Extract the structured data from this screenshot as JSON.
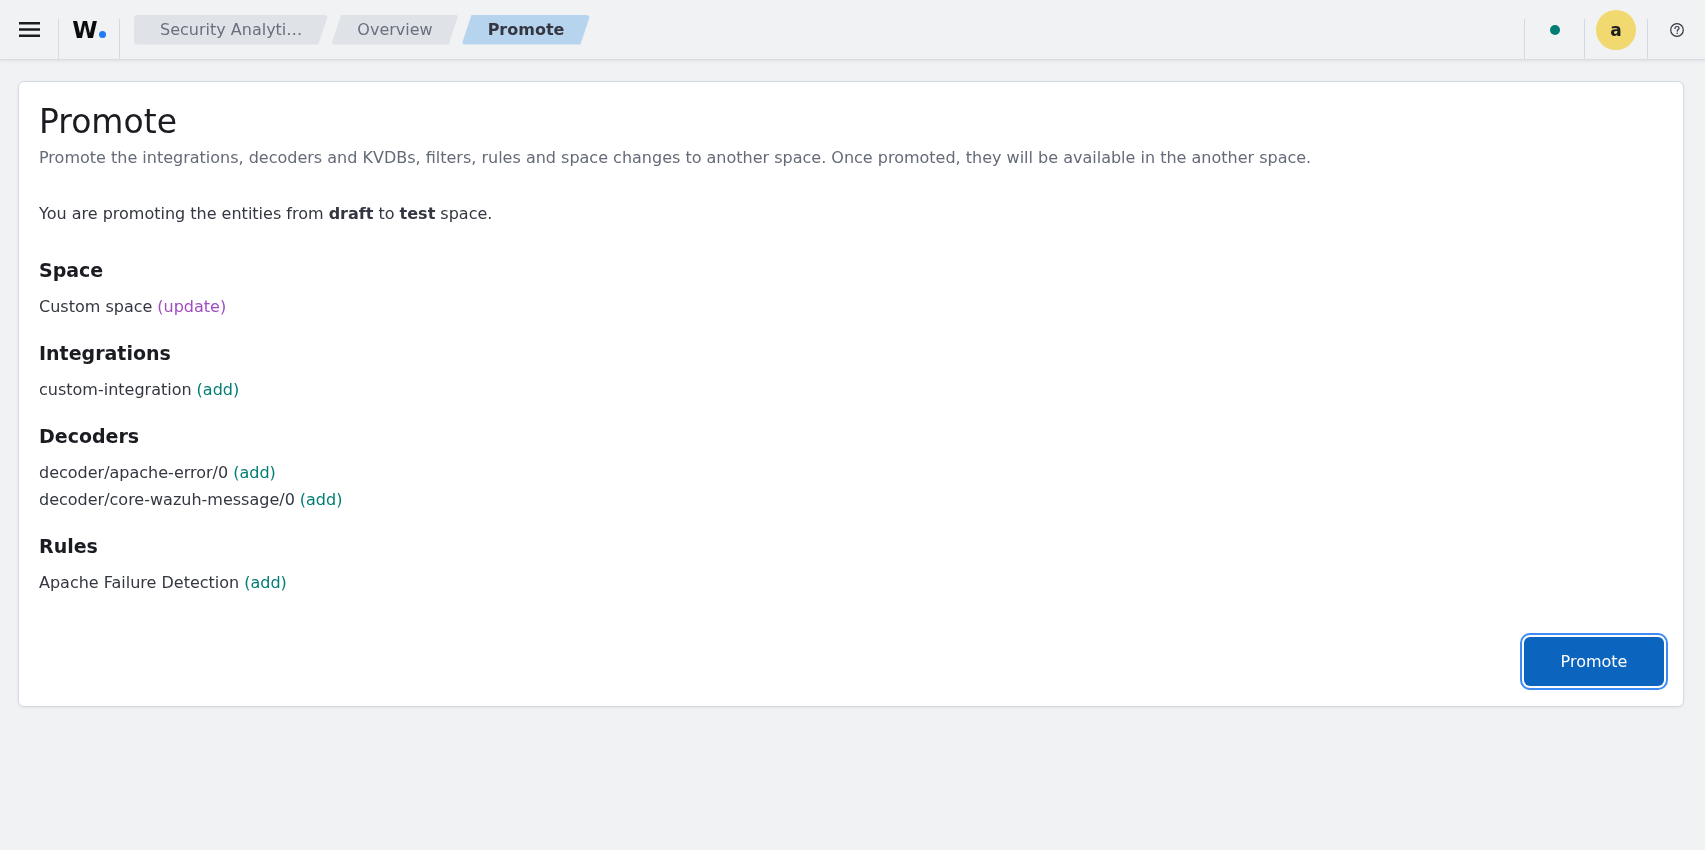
{
  "header": {
    "logo": "W",
    "breadcrumbs": [
      {
        "label": "Security Analyti…",
        "selected": false
      },
      {
        "label": "Overview",
        "selected": false
      },
      {
        "label": "Promote",
        "selected": true
      }
    ],
    "avatar": "a"
  },
  "page": {
    "title": "Promote",
    "description": "Promote the integrations, decoders and KVDBs, filters, rules and space changes to another space. Once promoted, they will be available in the another space.",
    "summary": "You are promoting the entities from **draft** to **test** space.",
    "sections": [
      {
        "heading": "Space",
        "items": [
          {
            "name": "Custom space",
            "action": "(update)",
            "kind": "update"
          }
        ]
      },
      {
        "heading": "Integrations",
        "items": [
          {
            "name": "custom-integration",
            "action": "(add)",
            "kind": "add"
          }
        ]
      },
      {
        "heading": "Decoders",
        "items": [
          {
            "name": "decoder/apache-error/0",
            "action": "(add)",
            "kind": "add"
          },
          {
            "name": "decoder/core-wazuh-message/0",
            "action": "(add)",
            "kind": "add"
          }
        ]
      },
      {
        "heading": "Rules",
        "items": [
          {
            "name": "Apache Failure Detection",
            "action": "(add)",
            "kind": "add"
          }
        ]
      }
    ]
  },
  "promote_button": {
    "label": "Promote",
    "focused": true
  }
}
